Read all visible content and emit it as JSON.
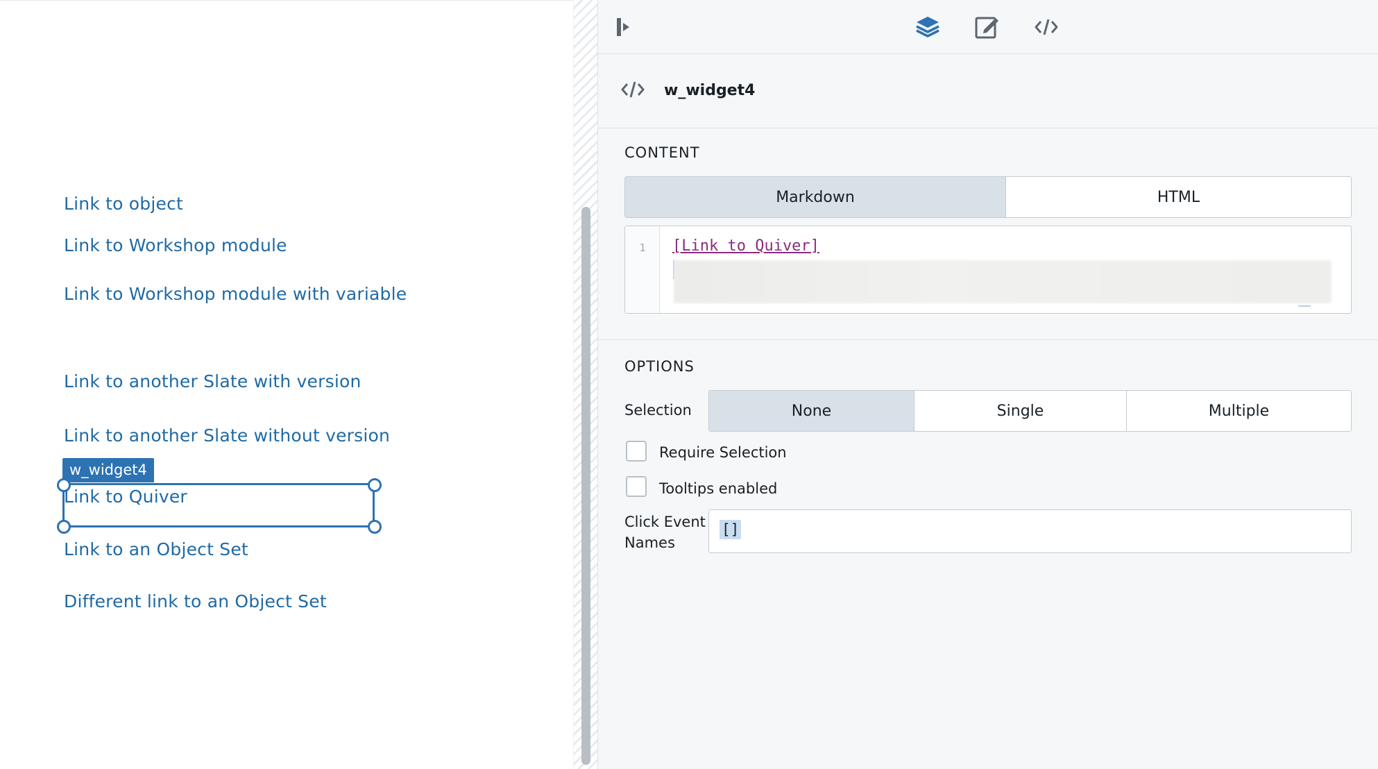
{
  "canvas": {
    "links": [
      "Link to object",
      "Link to Workshop module",
      "Link to Workshop module with variable",
      "Link to another Slate with version",
      "Link to another Slate without version",
      "Link to Quiver",
      "Link to an Object Set",
      "Different link to an Object Set"
    ],
    "selected_widget_tag": "w_widget4"
  },
  "toolbar": {
    "icons": [
      "collapse-panel-icon",
      "layers-icon",
      "edit-icon",
      "code-icon"
    ],
    "active_color": "#2d72b3"
  },
  "widget": {
    "name": "w_widget4",
    "icon": "code-icon"
  },
  "content": {
    "title": "CONTENT",
    "modes": [
      "Markdown",
      "HTML"
    ],
    "active_mode": "Markdown",
    "line_number": "1",
    "code": "[Link to Quiver]"
  },
  "options": {
    "title": "OPTIONS",
    "selection_label": "Selection",
    "selection_modes": [
      "None",
      "Single",
      "Multiple"
    ],
    "active_selection": "None",
    "require_selection_label": "Require Selection",
    "tooltips_label": "Tooltips enabled",
    "click_event_label_1": "Click Event",
    "click_event_label_2": "Names",
    "click_event_value": "[]"
  },
  "colors": {
    "link": "#1f6aa5",
    "selection": "#2d72b3",
    "code_link": "#8a2c7c"
  }
}
